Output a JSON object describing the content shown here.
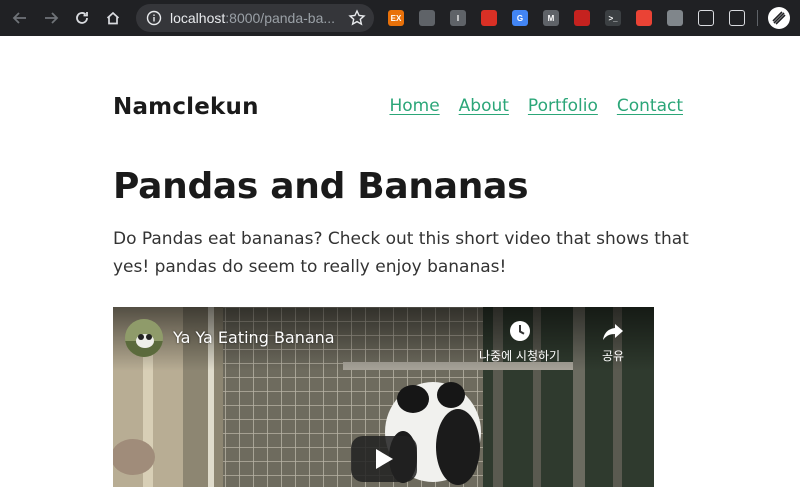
{
  "browser": {
    "url_host": "localhost",
    "url_rest": ":8000/panda-ba...",
    "extensions": [
      {
        "name": "ex-extension-icon",
        "label": "EX",
        "color": "#e8710a"
      },
      {
        "name": "card-extension-icon",
        "label": "",
        "color": "#5f6368"
      },
      {
        "name": "i-extension-icon",
        "label": "I",
        "color": "#5f6368"
      },
      {
        "name": "shield-extension-icon",
        "label": "",
        "color": "#d93025"
      },
      {
        "name": "translate-extension-icon",
        "label": "G",
        "color": "#4285f4"
      },
      {
        "name": "m-extension-icon",
        "label": "M",
        "color": "#5f6368"
      },
      {
        "name": "web-developer-extension-icon",
        "label": "",
        "color": "#c5221f"
      },
      {
        "name": "terminal-extension-icon",
        "label": ">_",
        "color": "#3c4043"
      },
      {
        "name": "note-extension-icon",
        "label": "",
        "color": "#ea4335"
      },
      {
        "name": "window-extension-icon",
        "label": "",
        "color": "#80868b"
      },
      {
        "name": "paw-extension-icon",
        "label": "",
        "color": "#202124"
      },
      {
        "name": "bulb-extension-icon",
        "label": "",
        "color": "#202124"
      }
    ]
  },
  "site": {
    "title": "Namclekun",
    "nav": [
      "Home",
      "About",
      "Portfolio",
      "Contact"
    ],
    "accent_color": "#2ba678"
  },
  "page": {
    "heading": "Pandas and Bananas",
    "intro": "Do Pandas eat bananas? Check out this short video that shows that yes! pandas do seem to really enjoy bananas!"
  },
  "video": {
    "title": "Ya Ya Eating Banana",
    "watch_later": "나중에 시청하기",
    "share": "공유"
  }
}
